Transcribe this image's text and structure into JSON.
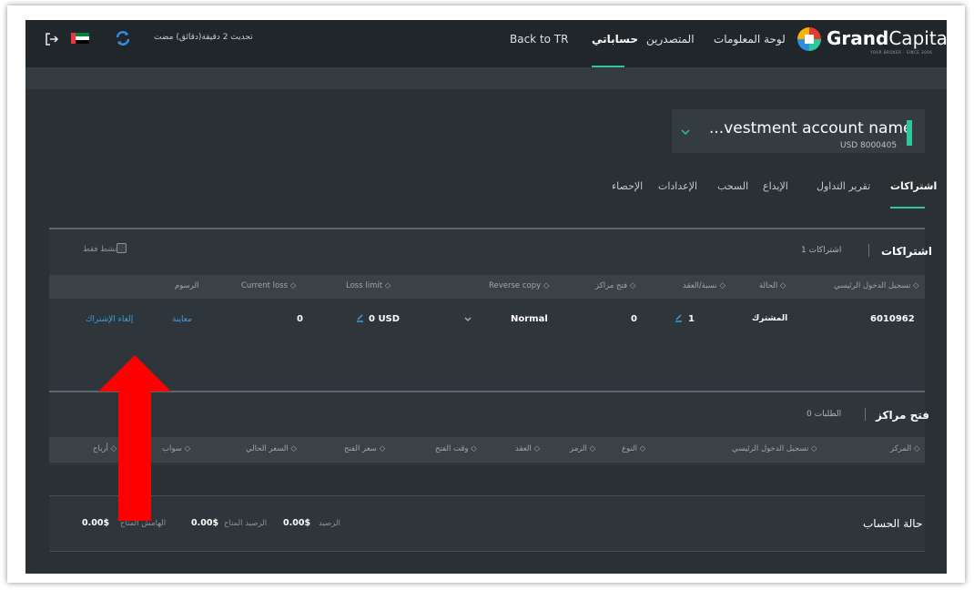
{
  "colors": {
    "accent": "#2ec69a",
    "link": "#3d9be0",
    "background": "#2a3034",
    "annotation_arrow": "#ff0000"
  },
  "header": {
    "logo_bold": "Grand",
    "logo_regular": "Capital",
    "logo_tagline": "YOUR BROKER · SINCE 2006",
    "nav": [
      "لوحة المعلومات",
      "المتصدرين",
      "حساباتي",
      "Back to TR"
    ],
    "active_nav": "حساباتي",
    "update_text": "تحديث 2 دقيقة(دقائق) مضت",
    "icons": [
      "logout-icon",
      "uae-flag-icon",
      "refresh-icon"
    ]
  },
  "account": {
    "name": "...vestment account name",
    "currency": "USD",
    "number": "8000405"
  },
  "tabs": {
    "items": [
      "اشتراكات",
      "تقرير التداول",
      "الإيداع",
      "السحب",
      "الإعدادات",
      "الإحصاء"
    ],
    "active": "اشتراكات"
  },
  "subscriptions": {
    "title": "اشتراكات",
    "count": "1 اشتراكات",
    "active_only_label": "نشط فقط",
    "columns": [
      "تسجيل الدخول الرئيسي ◇",
      "الحالة ◇",
      "نسبة/العقد ◇",
      "فتح مراكز ◇",
      "Reverse copy ◇",
      "Loss limit ◇",
      "Current loss ◇",
      "الرسوم"
    ],
    "row": {
      "login": "6010962",
      "status": "المشترك",
      "ratio": "1",
      "open_positions": "0",
      "reverse_copy": "Normal",
      "loss_limit": "0 USD",
      "current_loss": "0",
      "fees_link": "معاينة",
      "unsubscribe_link": "إلغاء الإشتراك"
    }
  },
  "open_positions": {
    "title": "فتح مراكز",
    "count": "0 الطلبات",
    "columns": [
      "المركز ◇",
      "تسجيل الدخول الرئيسي ◇",
      "النوع ◇",
      "الرمز ◇",
      "العقد ◇",
      "وقت الفتح ◇",
      "سعر الفتح ◇",
      "السعر الحالي ◇",
      "سواب ◇",
      "أرباح ◇"
    ]
  },
  "account_status": {
    "title": "حالة الحساب",
    "balance_label": "الرصيد",
    "balance_value": "0.00$",
    "available_balance_label": "الرصيد المتاح",
    "available_balance_value": "0.00$",
    "available_margin_label": "الهامش المتاح",
    "available_margin_value": "0.00$"
  }
}
